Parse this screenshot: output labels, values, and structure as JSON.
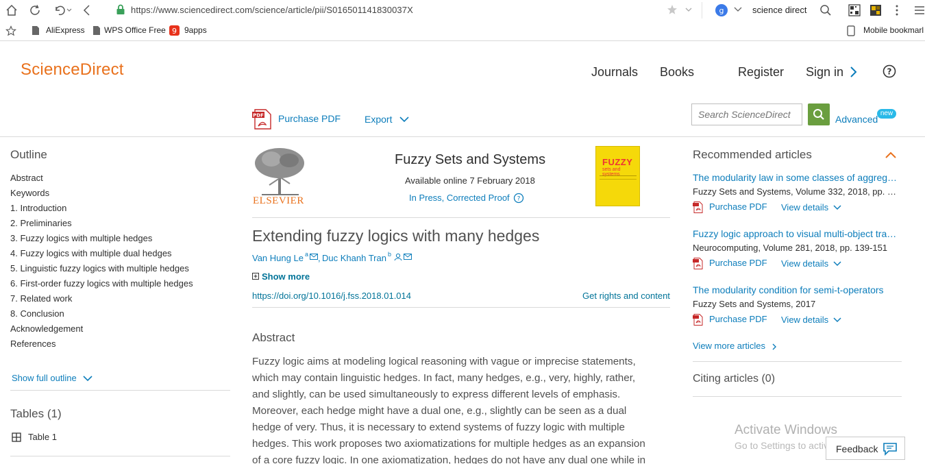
{
  "browser": {
    "url": "https://www.sciencedirect.com/science/article/pii/S016501141830037X",
    "search_engine_text": "science direct",
    "bookmarks": [
      "AliExpress",
      "WPS Office Free",
      "9apps"
    ],
    "mobile_bookmarks": "Mobile bookmarl"
  },
  "header": {
    "logo": "ScienceDirect",
    "nav": [
      "Journals",
      "Books",
      "Register",
      "Sign in"
    ],
    "purchase_pdf": "Purchase PDF",
    "export": "Export",
    "search_placeholder": "Search ScienceDirect",
    "advanced": "Advanced",
    "new_badge": "new"
  },
  "outline": {
    "title": "Outline",
    "items": [
      "Abstract",
      "Keywords",
      "1. Introduction",
      "2. Preliminaries",
      "3. Fuzzy logics with multiple hedges",
      "4. Fuzzy logics with multiple dual hedges",
      "5. Linguistic fuzzy logics with multiple hedges",
      "6. First-order fuzzy logics with multiple hedges",
      "7. Related work",
      "8. Conclusion",
      "Acknowledgement",
      "References"
    ],
    "show_full": "Show full outline",
    "tables_title": "Tables (1)",
    "table_item": "Table 1"
  },
  "article": {
    "publisher": "ELSEVIER",
    "journal": "Fuzzy Sets and Systems",
    "available": "Available online 7 February 2018",
    "status": "In Press, Corrected Proof",
    "cover_title": "FUZZY",
    "cover_sub": "sets and systems",
    "title": "Extending fuzzy logics with many hedges",
    "author1": "Van Hung Le",
    "author1_sup": "a",
    "author2": "Duc Khanh Tran",
    "author2_sup": "b",
    "show_more": "Show more",
    "doi": "https://doi.org/10.1016/j.fss.2018.01.014",
    "rights": "Get rights and content",
    "abstract_heading": "Abstract",
    "abstract_lines": [
      "Fuzzy logic aims at modeling logical reasoning with vague or imprecise statements,",
      "which may contain linguistic hedges. In fact, many hedges, e.g., very, highly, rather,",
      "and slightly, can be used simultaneously to express different levels of emphasis.",
      "Moreover, each hedge might have a dual one, e.g., slightly can be seen as a dual",
      "hedge of very. Thus, it is necessary to extend systems of fuzzy logic with multiple",
      "hedges. This work proposes two axiomatizations for multiple hedges as an expansion",
      "of a core fuzzy logic. In one axiomatization, hedges do not have any dual one while in"
    ]
  },
  "recommended": {
    "title": "Recommended articles",
    "items": [
      {
        "title": "The modularity law in some classes of aggreg…",
        "sub": "Fuzzy Sets and Systems, Volume 332, 2018, pp. …"
      },
      {
        "title": "Fuzzy logic approach to visual multi-object tra…",
        "sub": "Neurocomputing, Volume 281, 2018, pp. 139-151"
      },
      {
        "title": "The modularity condition for semi-t-operators",
        "sub": "Fuzzy Sets and Systems, 2017"
      }
    ],
    "purchase_pdf": "Purchase PDF",
    "view_details": "View details",
    "view_more": "View more articles",
    "citing": "Citing articles (0)"
  },
  "overlay": {
    "activate": "Activate Windows",
    "goto": "Go to Settings to activate Windows.",
    "feedback": "Feedback"
  },
  "colors": {
    "brand": "#e9711c",
    "link": "#0c7dbb",
    "search_green": "#6a9e3f",
    "badge": "#29b9e8"
  }
}
